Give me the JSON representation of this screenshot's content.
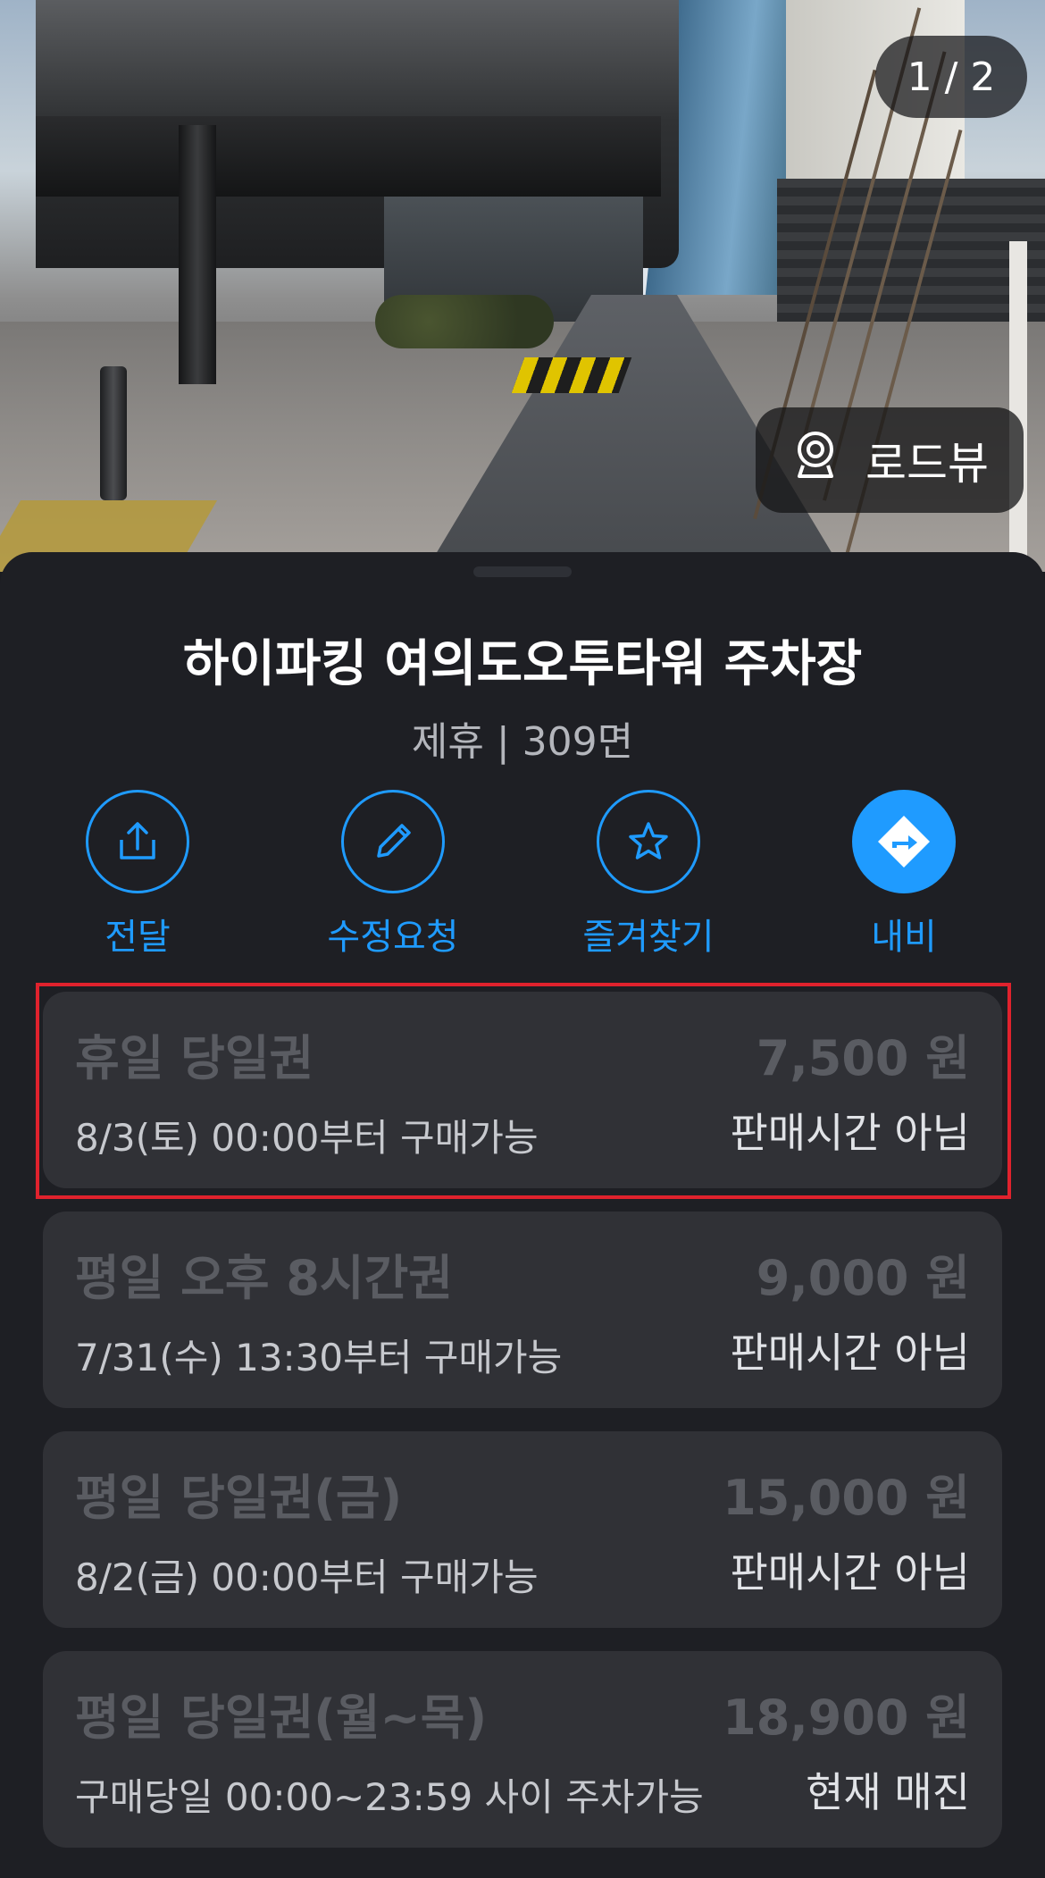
{
  "photo": {
    "counter": "1 / 2",
    "roadview_label": "로드뷰",
    "roadview_icon": "roadview-camera-icon"
  },
  "lot": {
    "name": "하이파킹 여의도오투타워 주차장",
    "info": "제휴 | 309면"
  },
  "actions": [
    {
      "label": "전달",
      "icon": "share-icon"
    },
    {
      "label": "수정요청",
      "icon": "pencil-icon"
    },
    {
      "label": "즐겨찾기",
      "icon": "star-icon"
    },
    {
      "label": "내비",
      "icon": "navigation-icon"
    }
  ],
  "tickets": [
    {
      "name": "휴일 당일권",
      "price": "7,500 원",
      "note": "8/3(토) 00:00부터 구매가능",
      "status": "판매시간 아님"
    },
    {
      "name": "평일 오후 8시간권",
      "price": "9,000 원",
      "note": "7/31(수) 13:30부터 구매가능",
      "status": "판매시간 아님"
    },
    {
      "name": "평일 당일권(금)",
      "price": "15,000 원",
      "note": "8/2(금) 00:00부터 구매가능",
      "status": "판매시간 아님"
    },
    {
      "name": "평일 당일권(월~목)",
      "price": "18,900 원",
      "note": "구매당일 00:00~23:59 사이 주차가능",
      "status": "현재 매진"
    }
  ],
  "colors": {
    "accent": "#1f9bff",
    "background": "#1e1f24",
    "card": "#303136",
    "highlight": "#e0222d"
  }
}
